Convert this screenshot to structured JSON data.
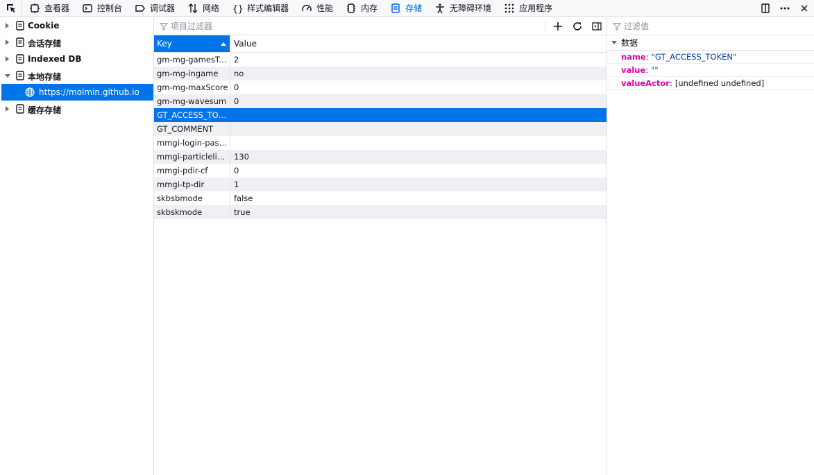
{
  "toolbar": {
    "tabs": [
      {
        "label": "查看器",
        "icon": "inspector-icon"
      },
      {
        "label": "控制台",
        "icon": "console-icon"
      },
      {
        "label": "调试器",
        "icon": "debugger-icon"
      },
      {
        "label": "网络",
        "icon": "network-icon"
      },
      {
        "label": "样式编辑器",
        "icon": "style-editor-icon"
      },
      {
        "label": "性能",
        "icon": "performance-icon"
      },
      {
        "label": "内存",
        "icon": "memory-icon"
      },
      {
        "label": "存储",
        "icon": "storage-icon"
      },
      {
        "label": "无障碍环境",
        "icon": "accessibility-icon"
      },
      {
        "label": "应用程序",
        "icon": "application-icon"
      }
    ],
    "selected_tab": "存储",
    "accent_color": "#0061e0"
  },
  "tree": {
    "items": [
      {
        "label": "Cookie",
        "expanded": false
      },
      {
        "label": "会话存储",
        "expanded": false
      },
      {
        "label": "Indexed DB",
        "expanded": false
      },
      {
        "label": "本地存储",
        "expanded": true
      },
      {
        "label": "https://molmin.github.io",
        "child": true,
        "selected": true
      },
      {
        "label": "缓存存储",
        "expanded": false
      }
    ]
  },
  "table": {
    "filter_placeholder": "项目过滤器",
    "columns": {
      "key": "Key",
      "value": "Value"
    },
    "sort_column": "Key",
    "sort_direction": "ascending",
    "rows": [
      {
        "key": "gm-mg-gamesTotal",
        "value": "2"
      },
      {
        "key": "gm-mg-ingame",
        "value": "no"
      },
      {
        "key": "gm-mg-maxScore",
        "value": "0"
      },
      {
        "key": "gm-mg-wavesum",
        "value": "0"
      },
      {
        "key": "GT_ACCESS_TOKEN",
        "value": "",
        "selected": true
      },
      {
        "key": "GT_COMMENT",
        "value": ""
      },
      {
        "key": "mmgi-login-pass…",
        "value": ""
      },
      {
        "key": "mmgi-particleline…",
        "value": "130"
      },
      {
        "key": "mmgi-pdir-cf",
        "value": "0"
      },
      {
        "key": "mmgi-tp-dir",
        "value": "1"
      },
      {
        "key": "skbsbmode",
        "value": "false"
      },
      {
        "key": "skbskmode",
        "value": "true"
      }
    ],
    "selection_color": "#0074e8"
  },
  "sidebar": {
    "filter_placeholder": "过滤值",
    "section_title": "数据",
    "props": [
      {
        "name": "name",
        "value": "\"GT_ACCESS_TOKEN\"",
        "type": "string"
      },
      {
        "name": "value",
        "value": "\"\"",
        "type": "string"
      },
      {
        "name": "valueActor",
        "value": "[undefined undefined]",
        "type": "plain"
      }
    ]
  }
}
